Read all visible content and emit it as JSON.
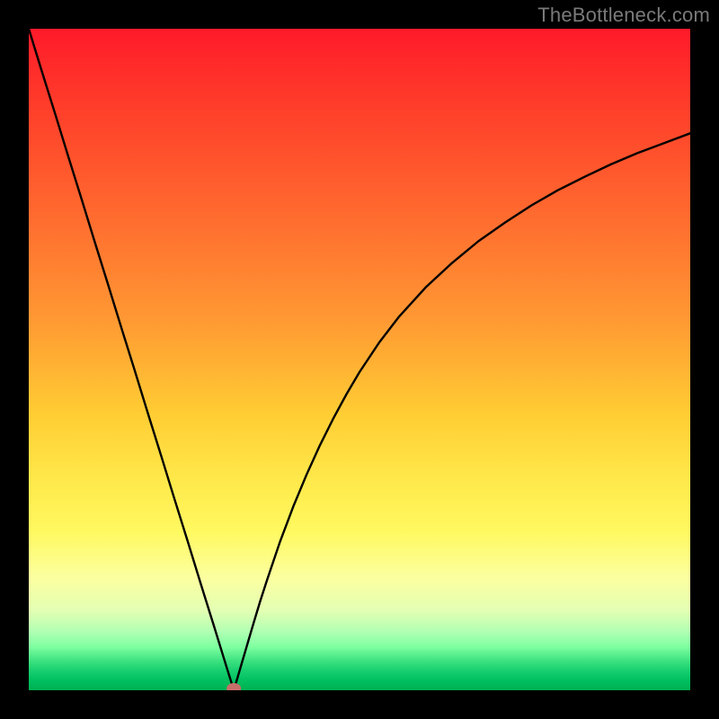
{
  "watermark": "TheBottleneck.com",
  "chart_data": {
    "type": "line",
    "title": "",
    "xlabel": "",
    "ylabel": "",
    "xlim": [
      0,
      100
    ],
    "ylim": [
      0,
      100
    ],
    "x": [
      0,
      2,
      4,
      6,
      8,
      10,
      12,
      14,
      16,
      18,
      20,
      22,
      24,
      26,
      28,
      30,
      31,
      32,
      33,
      34,
      35,
      36,
      38,
      40,
      42,
      44,
      46,
      48,
      50,
      53,
      56,
      60,
      64,
      68,
      72,
      76,
      80,
      84,
      88,
      92,
      96,
      100
    ],
    "y": [
      100,
      93.5,
      87.1,
      80.6,
      74.2,
      67.7,
      61.3,
      54.8,
      48.4,
      41.9,
      35.5,
      29.0,
      22.6,
      16.1,
      9.7,
      3.2,
      0,
      3.4,
      6.8,
      10.2,
      13.5,
      16.6,
      22.5,
      27.8,
      32.6,
      37.0,
      41.0,
      44.7,
      48.1,
      52.6,
      56.5,
      60.9,
      64.6,
      67.9,
      70.7,
      73.3,
      75.6,
      77.6,
      79.5,
      81.2,
      82.7,
      84.2
    ],
    "marker": {
      "x": 31,
      "y": 0,
      "color": "#c96f6a",
      "radius_px": 7
    },
    "grid": false,
    "legend": false
  }
}
